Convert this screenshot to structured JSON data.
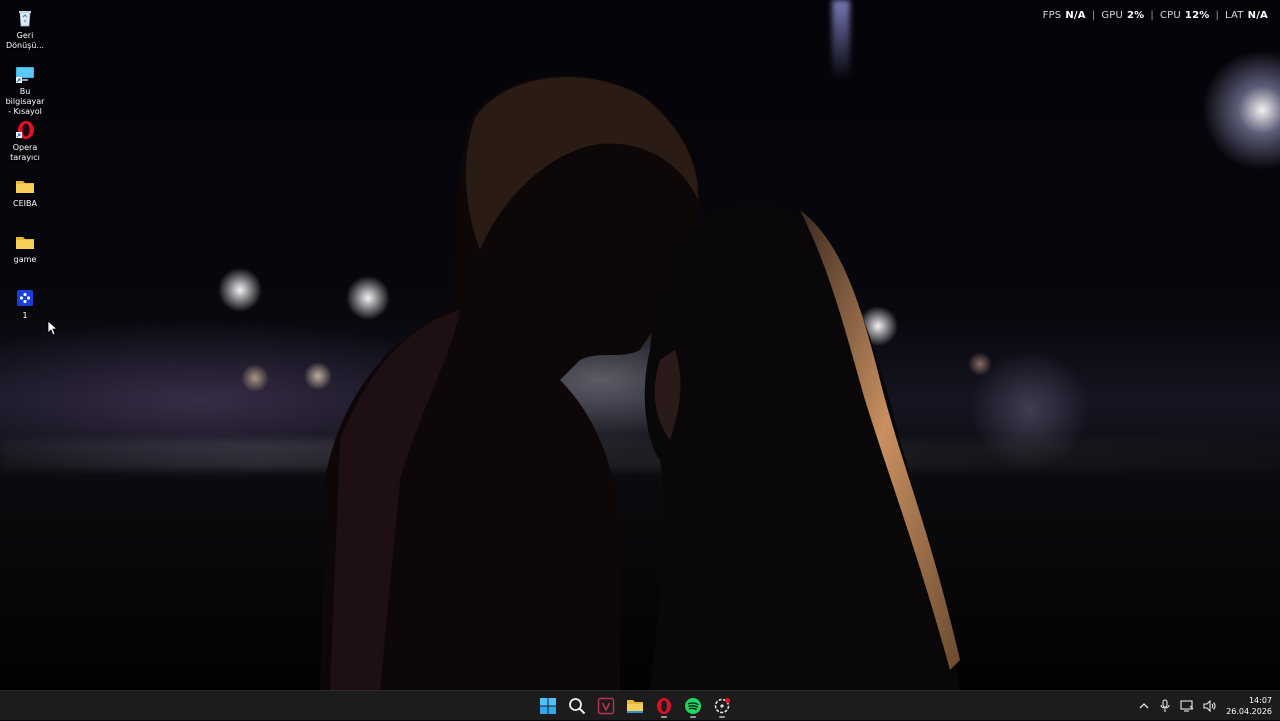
{
  "overlay": {
    "fps_label": "FPS",
    "fps_value": "N/A",
    "gpu_label": "GPU",
    "gpu_value": "2%",
    "cpu_label": "CPU",
    "cpu_value": "12%",
    "lat_label": "LAT",
    "lat_value": "N/A",
    "separator": "|"
  },
  "desktop_icons": [
    {
      "label": "Geri\nDönüşü...",
      "icon": "recycle-bin-icon"
    },
    {
      "label": "Bu bilgisayar\n- Kısayol",
      "icon": "this-pc-icon"
    },
    {
      "label": "Opera\ntarayıcı",
      "icon": "opera-icon"
    },
    {
      "label": "CEIBA",
      "icon": "folder-icon"
    },
    {
      "label": "game",
      "icon": "folder-icon"
    },
    {
      "label": "1",
      "icon": "app-icon"
    }
  ],
  "taskbar": {
    "apps": [
      {
        "name": "start",
        "icon": "windows-start-icon"
      },
      {
        "name": "search",
        "icon": "search-icon"
      },
      {
        "name": "app-v",
        "icon": "v-app-icon"
      },
      {
        "name": "file-explorer",
        "icon": "folder-icon"
      },
      {
        "name": "opera",
        "icon": "opera-icon"
      },
      {
        "name": "spotify",
        "icon": "spotify-icon"
      },
      {
        "name": "steelseries",
        "icon": "gg-app-icon"
      }
    ],
    "time": "14:07",
    "date": "26.04.2026"
  },
  "colors": {
    "taskbar_bg": "#1c1c1c",
    "folder": "#f2c94c",
    "opera": "#e0102b",
    "spotify": "#1ed760",
    "windows": "#4cc2ff"
  }
}
